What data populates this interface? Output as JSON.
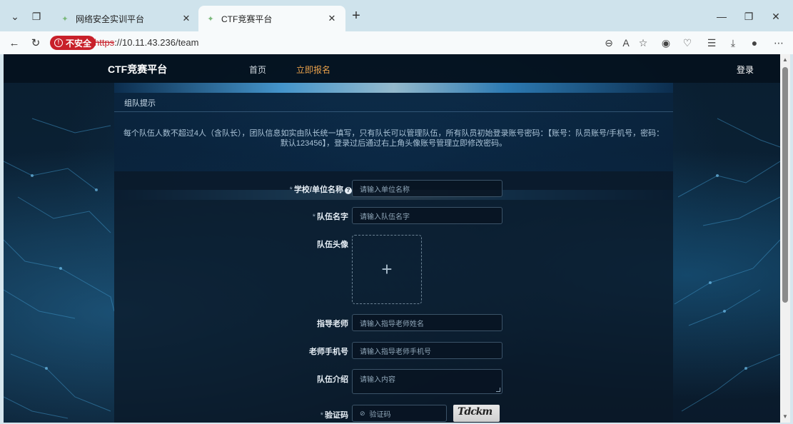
{
  "browser": {
    "tabs": [
      {
        "title": "网络安全实训平台",
        "active": false
      },
      {
        "title": "CTF竞赛平台",
        "active": true
      }
    ],
    "security_label": "不安全",
    "url_protocol": "https",
    "url_rest": "://10.11.43.236/team"
  },
  "site": {
    "logo": "CTF竞赛平台",
    "nav": [
      {
        "label": "首页",
        "active": false
      },
      {
        "label": "立即报名",
        "active": true
      }
    ],
    "login": "登录"
  },
  "tip": {
    "title": "组队提示",
    "text": "每个队伍人数不超过4人（含队长），团队信息如实由队长统一填写，只有队长可以管理队伍，所有队员初始登录账号密码：【账号：队员账号/手机号，密码：默认123456】，登录过后通过右上角头像账号管理立即修改密码。"
  },
  "form": {
    "school": {
      "label": "学校/单位名称",
      "placeholder": "请输入单位名称"
    },
    "team_name": {
      "label": "队伍名字",
      "placeholder": "请输入队伍名字"
    },
    "avatar": {
      "label": "队伍头像",
      "upload_glyph": "+"
    },
    "teacher": {
      "label": "指导老师",
      "placeholder": "请输入指导老师姓名"
    },
    "teacher_phone": {
      "label": "老师手机号",
      "placeholder": "请输入指导老师手机号"
    },
    "intro": {
      "label": "队伍介绍",
      "placeholder": "请输入内容"
    },
    "captcha": {
      "label": "验证码",
      "placeholder": "验证码",
      "image_text": "Tdckm"
    }
  },
  "colors": {
    "accent": "#e8a04a",
    "insecure": "#c8202a",
    "page_bg": "#0b2236"
  }
}
